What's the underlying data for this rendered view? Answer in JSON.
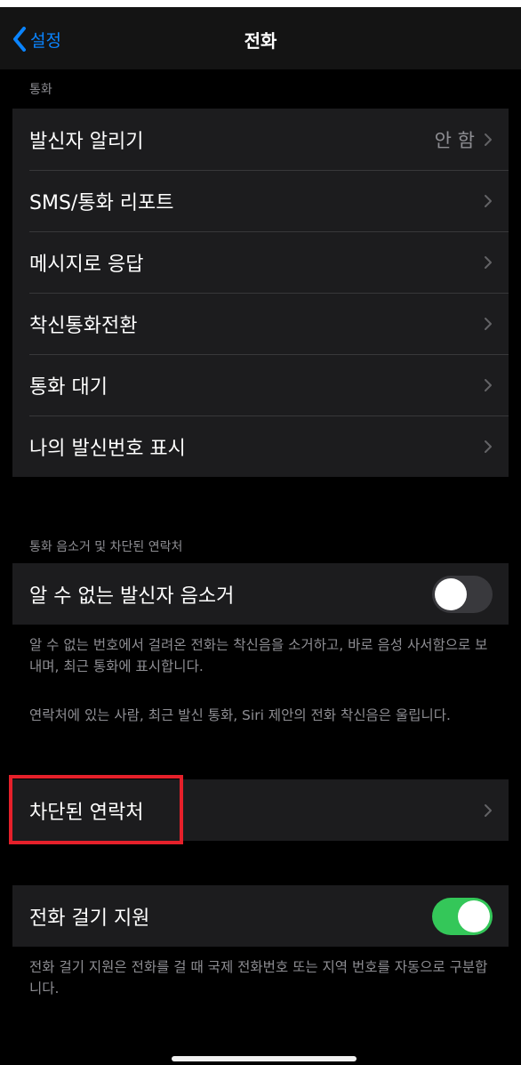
{
  "nav": {
    "back_label": "설정",
    "title": "전화"
  },
  "sections": {
    "calls_header": "통화",
    "calls_rows": [
      {
        "label": "발신자 알리기",
        "value": "안 함"
      },
      {
        "label": "SMS/통화 리포트"
      },
      {
        "label": "메시지로 응답"
      },
      {
        "label": "착신통화전환"
      },
      {
        "label": "통화 대기"
      },
      {
        "label": "나의 발신번호 표시"
      }
    ],
    "silence_header": "통화 음소거 및 차단된 연락처",
    "silence_unknown": {
      "label": "알 수 없는 발신자 음소거",
      "toggle": "off"
    },
    "silence_footnote_1": "알 수 없는 번호에서 걸려온 전화는 착신음을 소거하고, 바로 음성 사서함으로 보내며, 최근 통화에 표시합니다.",
    "silence_footnote_2": "연락처에 있는 사람, 최근 발신 통화, Siri 제안의 전화 착신음은 울립니다.",
    "blocked_contacts": {
      "label": "차단된 연락처"
    },
    "dial_assist": {
      "label": "전화 걸기 지원",
      "toggle": "on"
    },
    "dial_assist_footnote": "전화 걸기 지원은 전화를 걸 때 국제 전화번호 또는 지역 번호를 자동으로 구분합니다."
  },
  "colors": {
    "accent": "#0a84ff",
    "toggle_on": "#34c759",
    "highlight_box": "#e5202a"
  },
  "icons": {
    "back": "chevron-left-icon",
    "disclosure": "chevron-right-icon"
  }
}
